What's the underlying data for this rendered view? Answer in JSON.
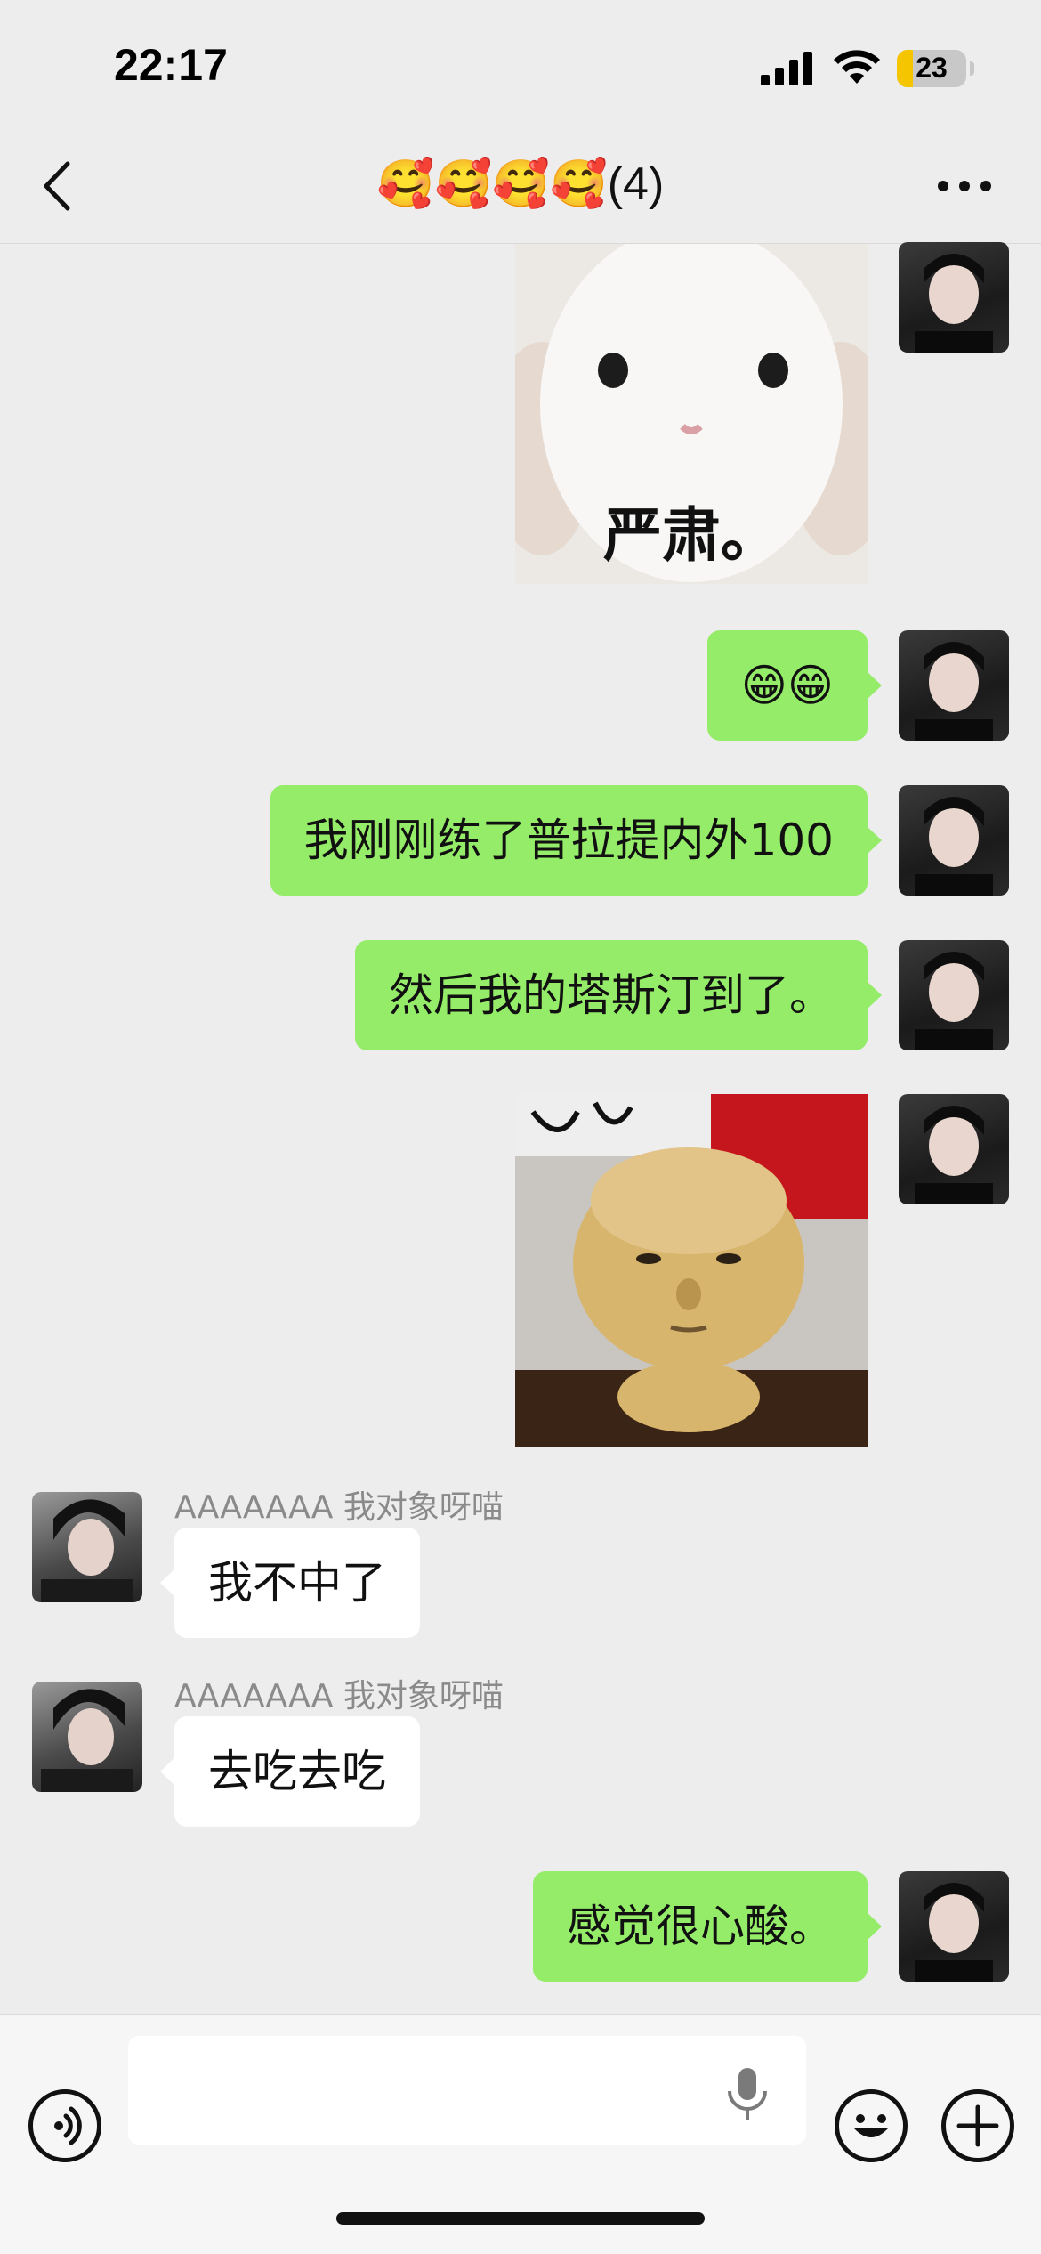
{
  "status_bar": {
    "time": "22:17",
    "battery_level": "23",
    "battery_fraction": 0.23
  },
  "nav": {
    "title": "🥰🥰🥰🥰(4)",
    "back_icon": "chevron-left-icon",
    "more_icon": "more-dots-icon"
  },
  "messages": [
    {
      "type": "sticker",
      "from": "me",
      "caption": "严肃。",
      "description": "white bunny"
    },
    {
      "type": "text",
      "from": "me",
      "text": "😁😁"
    },
    {
      "type": "text",
      "from": "me",
      "text": "我刚刚练了普拉提内外100"
    },
    {
      "type": "text",
      "from": "me",
      "text": "然后我的塔斯汀到了。"
    },
    {
      "type": "sticker",
      "from": "me",
      "caption": "",
      "description": "bread face figure"
    },
    {
      "type": "text",
      "from": "other",
      "sender": "AAAAAAA 我对象呀喵",
      "text": "我不中了"
    },
    {
      "type": "text",
      "from": "other",
      "sender": "AAAAAAA 我对象呀喵",
      "text": "去吃去吃"
    },
    {
      "type": "text",
      "from": "me",
      "text": "感觉很心酸。"
    }
  ],
  "input_bar": {
    "value": "",
    "voice_icon": "voice-icon",
    "mic_icon": "mic-icon",
    "emoji_icon": "emoji-icon",
    "plus_icon": "plus-icon"
  },
  "colors": {
    "background": "#ededed",
    "my_bubble": "#95ec69",
    "other_bubble": "#ffffff",
    "sender_name": "#8a8a8a",
    "battery": "#f5c500"
  }
}
